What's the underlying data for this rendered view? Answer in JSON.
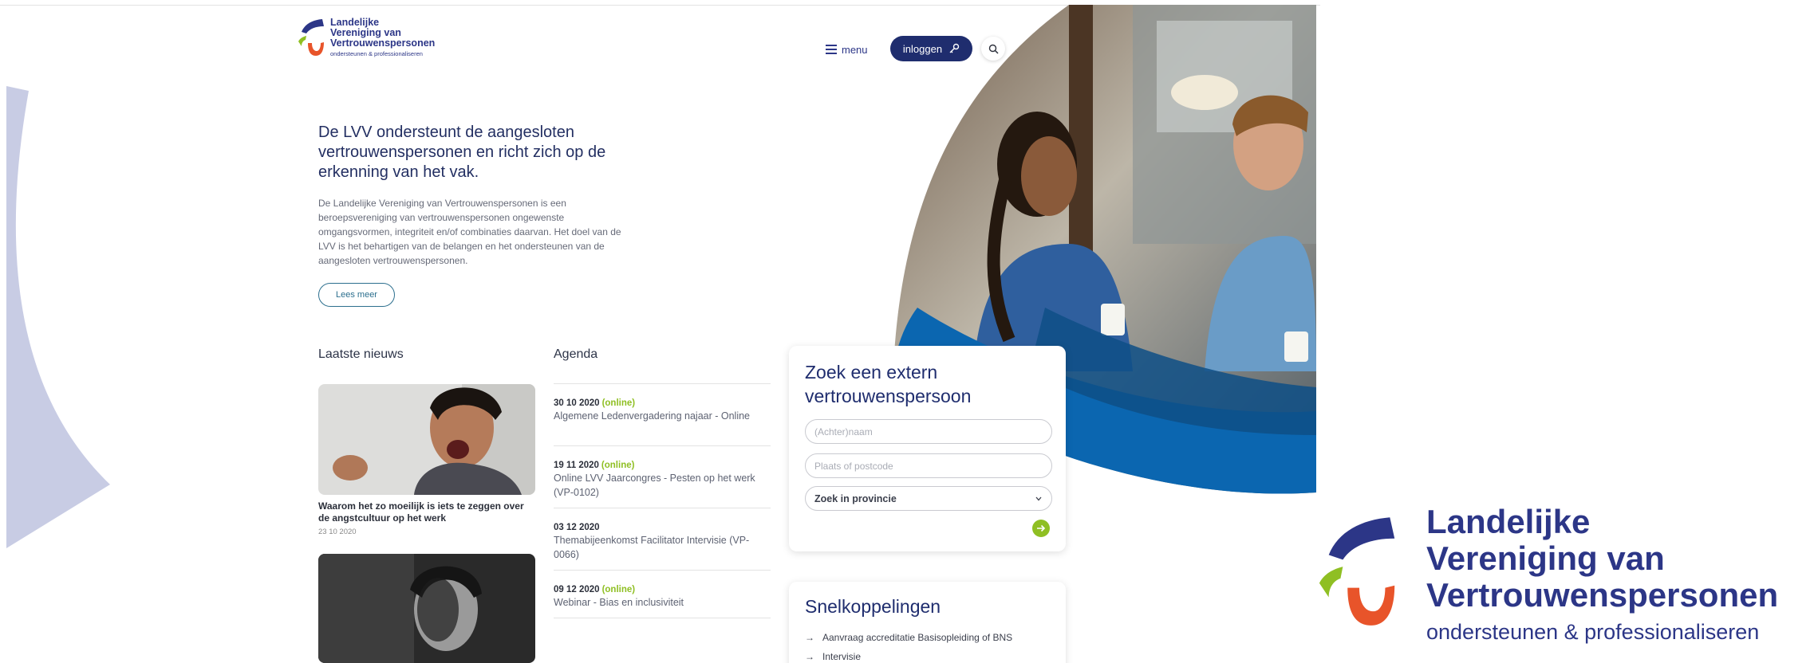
{
  "logo": {
    "line1": "Landelijke",
    "line2": "Vereniging van",
    "line3": "Vertrouwenspersonen",
    "tagline": "ondersteunen & professionaliseren"
  },
  "header": {
    "menu_label": "menu",
    "login_label": "inloggen"
  },
  "intro": {
    "title": "De LVV ondersteunt de aangesloten vertrouwenspersonen en richt zich op de erkenning van het vak.",
    "body": "De Landelijke Vereniging van Vertrouwenspersonen is een beroepsvereniging van vertrouwenspersonen ongewenste omgangsvormen, integriteit en/of combinaties daarvan. Het doel van de LVV is het behartigen van de belangen en het ondersteunen van de aangesloten vertrouwenspersonen.",
    "more_label": "Lees meer"
  },
  "news": {
    "heading": "Laatste nieuws",
    "items": [
      {
        "title": "Waarom het zo moeilijk is iets te zeggen over de angstcultuur op het werk",
        "date": "23 10 2020"
      }
    ]
  },
  "agenda": {
    "heading": "Agenda",
    "items": [
      {
        "date": "30 10 2020",
        "tag": "(online)",
        "text": "Algemene Ledenvergadering najaar - Online"
      },
      {
        "date": "19 11 2020",
        "tag": "(online)",
        "text": "Online LVV Jaarcongres - Pesten op het werk (VP-0102)"
      },
      {
        "date": "03 12 2020",
        "tag": "",
        "text": "Themabijeenkomst Facilitator Intervisie (VP-0066)"
      },
      {
        "date": "09 12 2020",
        "tag": "(online)",
        "text": "Webinar - Bias en inclusiviteit"
      }
    ]
  },
  "search_card": {
    "title": "Zoek een extern vertrouwenspersoon",
    "name_placeholder": "(Achter)naam",
    "place_placeholder": "Plaats of postcode",
    "province_selected": "Zoek in provincie"
  },
  "quicklinks": {
    "title": "Snelkoppelingen",
    "items": [
      {
        "label": "Aanvraag accreditatie Basisopleiding of BNS"
      },
      {
        "label": "Intervisie"
      }
    ]
  },
  "colors": {
    "navy": "#1f2d6e",
    "logo_blue": "#2c3687",
    "accent_green": "#8fbf23",
    "logo_orange": "#e8542a",
    "shape_lavender": "#c8cce4"
  }
}
